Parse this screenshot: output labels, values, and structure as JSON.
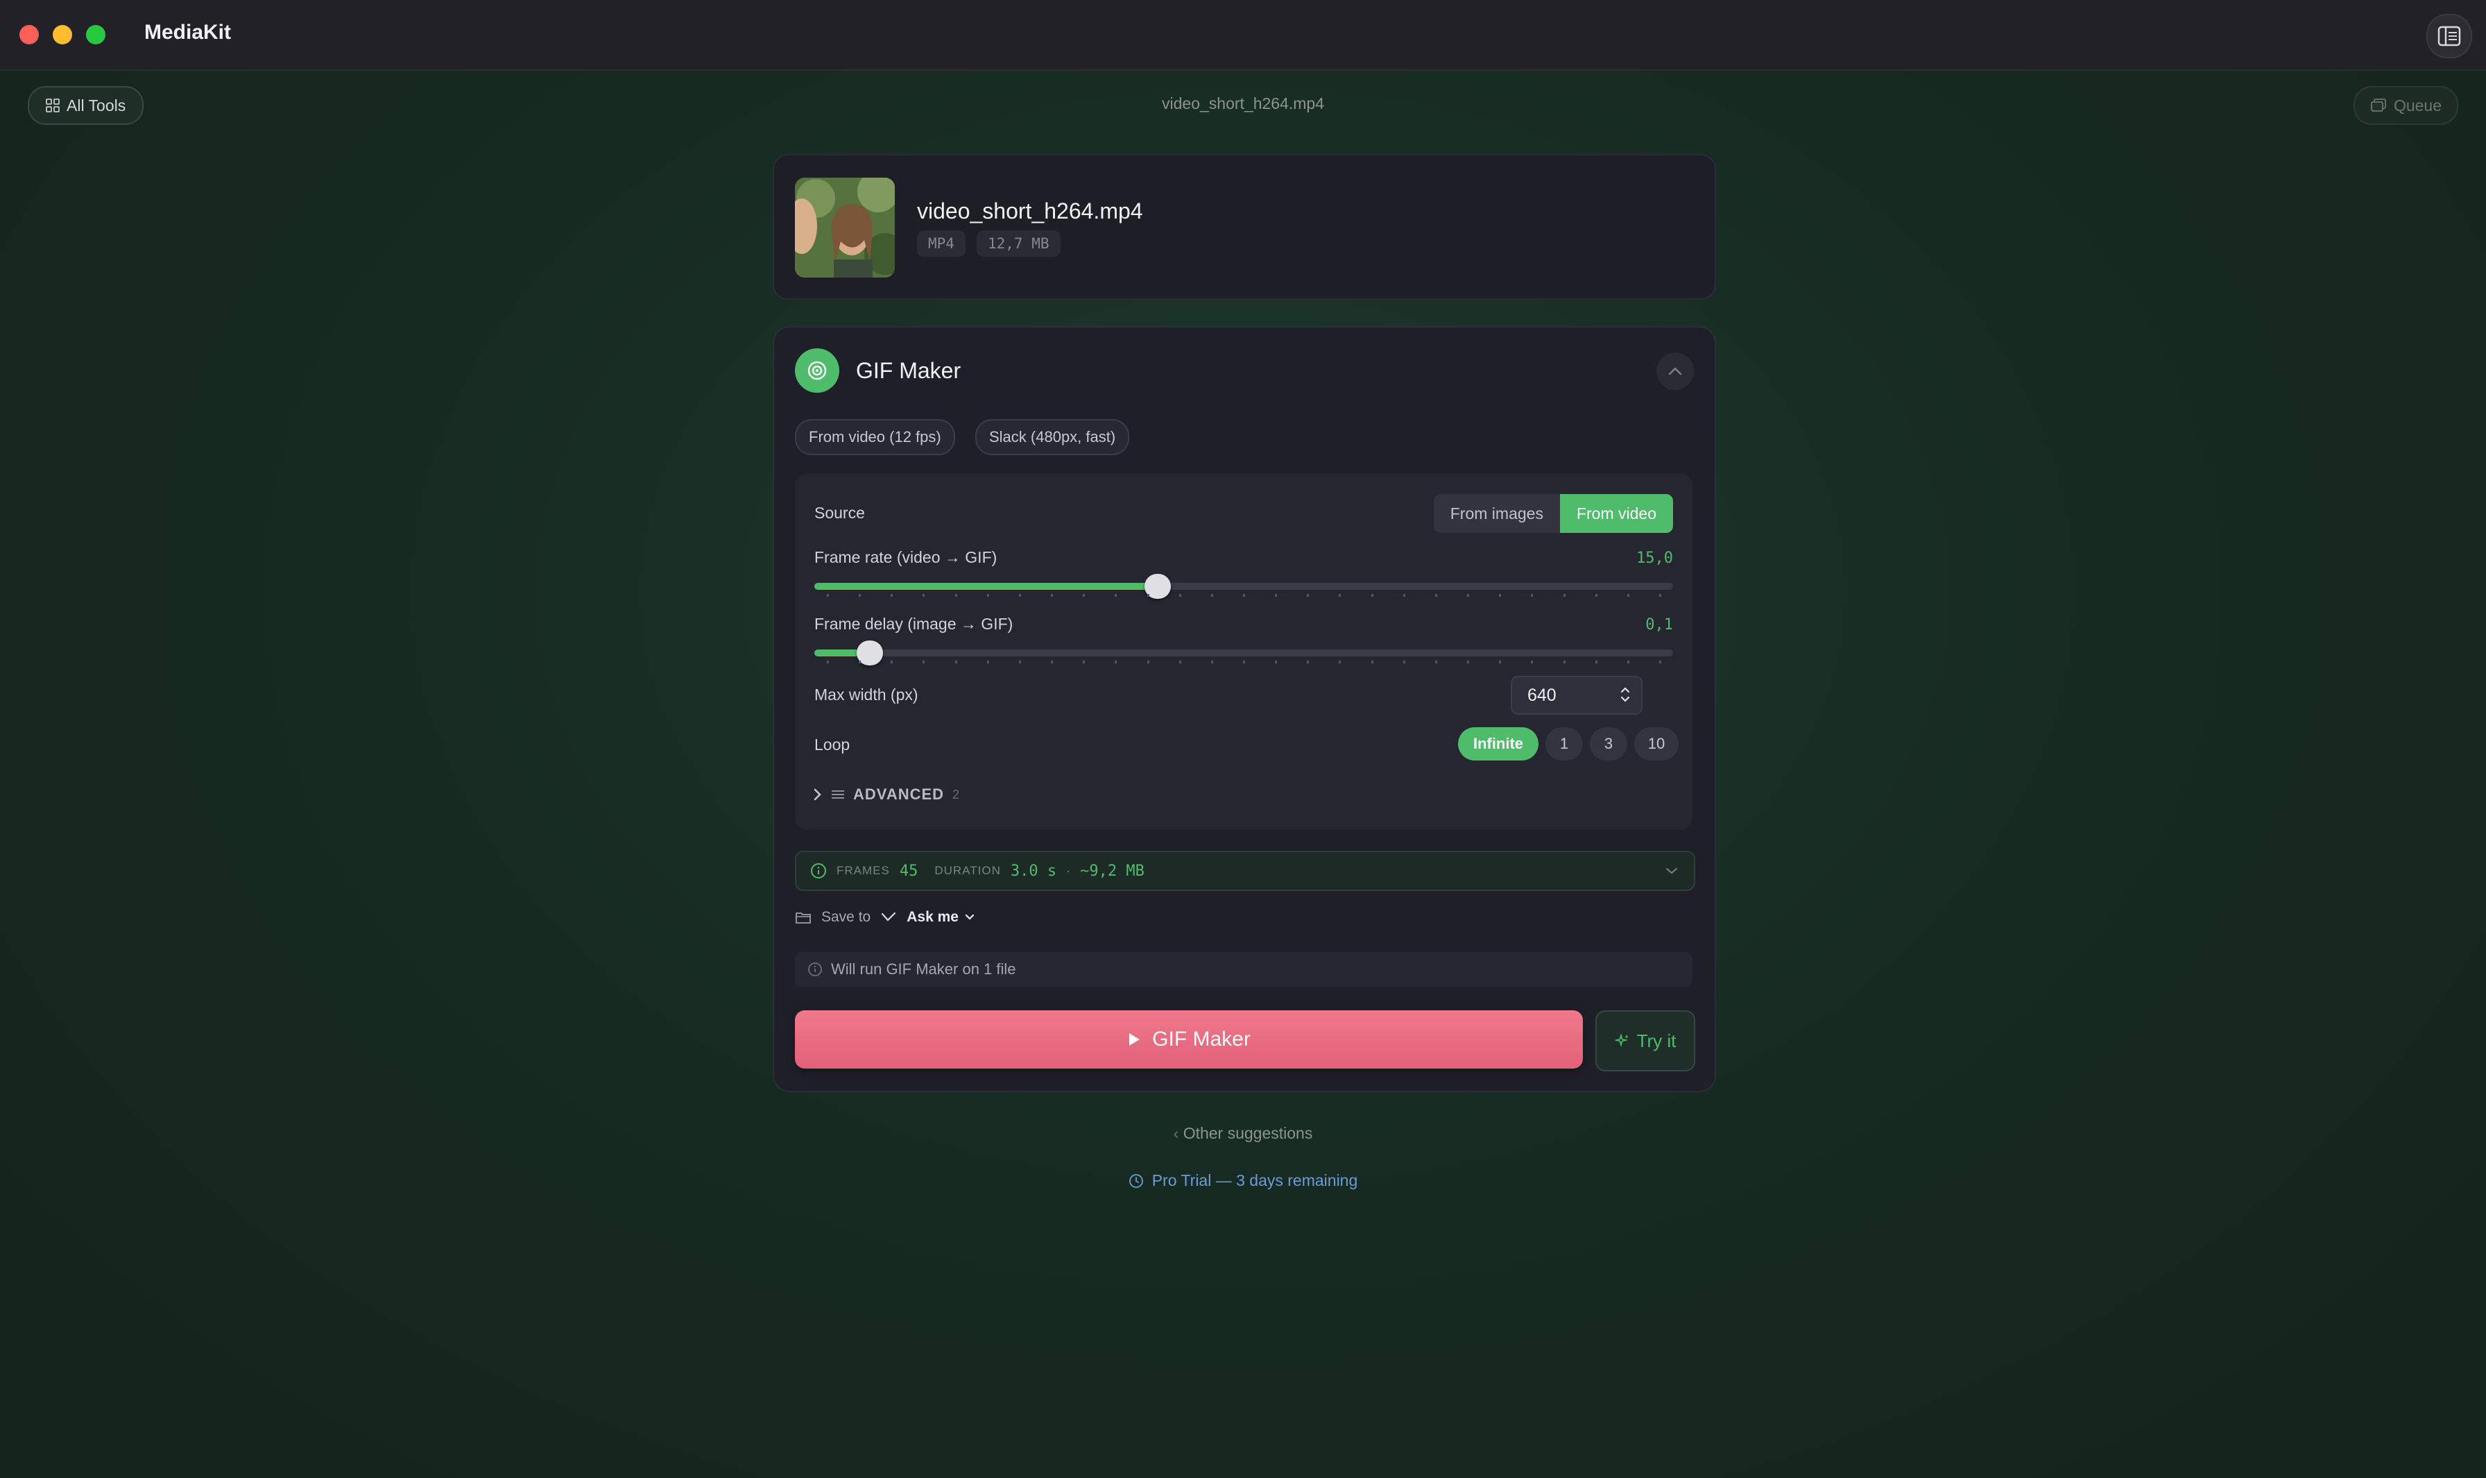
{
  "window": {
    "title": "MediaKit"
  },
  "toolbar": {
    "all_tools_label": "All Tools",
    "current_file": "video_short_h264.mp4",
    "queue_label": "Queue"
  },
  "file": {
    "name": "video_short_h264.mp4",
    "format": "MP4",
    "size": "12,7 MB"
  },
  "tool": {
    "title": "GIF Maker",
    "presets": [
      "From video (12 fps)",
      "Slack (480px, fast)"
    ]
  },
  "settings": {
    "source_label": "Source",
    "source_options": [
      "From images",
      "From video"
    ],
    "source_selected": "From video",
    "frame_rate_label": "Frame rate (video → GIF)",
    "frame_rate_value": "15,0",
    "frame_rate_fraction": 0.4,
    "frame_delay_label": "Frame delay (image → GIF)",
    "frame_delay_value": "0,1",
    "frame_delay_fraction": 0.065,
    "max_width_label": "Max width (px)",
    "max_width_value": "640",
    "loop_label": "Loop",
    "loop_options": [
      "Infinite",
      "1",
      "3",
      "10"
    ],
    "loop_selected": "Infinite",
    "advanced_label": "ADVANCED",
    "advanced_count": "2"
  },
  "summary": {
    "frames_label": "FRAMES",
    "frames_value": "45",
    "duration_label": "DURATION",
    "duration_value": "3.0 s",
    "separator": "·",
    "size_estimate": "~9,2 MB"
  },
  "save": {
    "label": "Save to",
    "value": "Ask me"
  },
  "notice": "Will run GIF Maker on 1 file",
  "actions": {
    "run_label": "GIF Maker",
    "try_label": "Try it"
  },
  "footer": {
    "other_suggestions": "Other suggestions",
    "trial": "Pro Trial — 3 days remaining"
  },
  "colors": {
    "accent": "#4fbc6b",
    "run_button": "#e8677e",
    "trial_link": "#6c9bd8"
  }
}
